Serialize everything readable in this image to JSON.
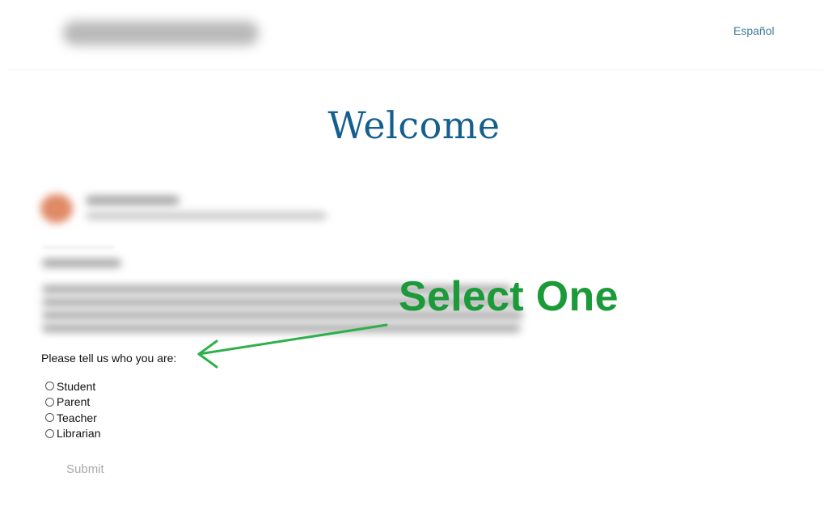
{
  "header": {
    "logo": "redacted-logo",
    "language_link": "Español"
  },
  "main": {
    "title": "Welcome",
    "form": {
      "prompt": "Please tell us who you are:",
      "options": [
        {
          "label": "Student",
          "selected": false
        },
        {
          "label": "Parent",
          "selected": false
        },
        {
          "label": "Teacher",
          "selected": false
        },
        {
          "label": "Librarian",
          "selected": false
        }
      ],
      "submit_label": "Submit"
    }
  },
  "annotation": {
    "text": "Select One",
    "color": "#1c9a3a"
  },
  "colors": {
    "title": "#155f8f",
    "link": "#3f7e9a",
    "submit_disabled": "#a9a9a9"
  }
}
